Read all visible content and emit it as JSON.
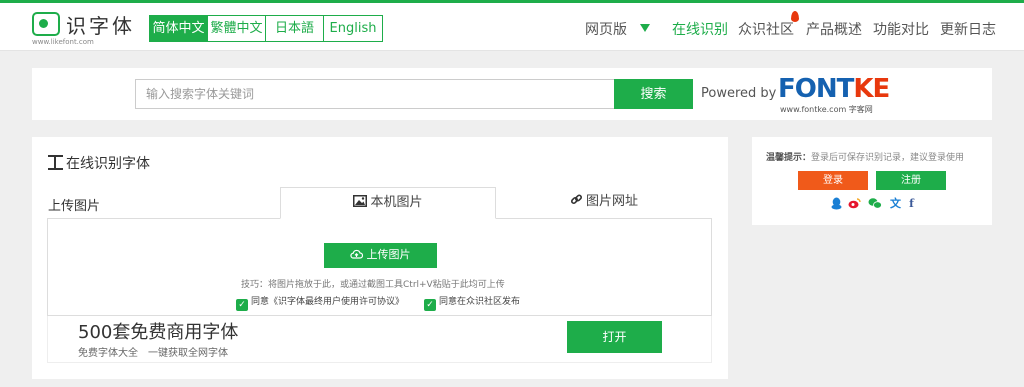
{
  "colors": {
    "brand": "#1ead4a",
    "login": "#f05a1a",
    "fontke_red": "#e8380d",
    "fontke_blue": "#1561b0"
  },
  "header": {
    "logo_name": "识字体",
    "logo_url_text": "www.likefont.com",
    "languages": [
      "简体中文",
      "繁體中文",
      "日本語",
      "English"
    ],
    "active_language": "简体中文",
    "nav": {
      "web_version": "网页版",
      "online_recognize": "在线识别",
      "community": "众识社区",
      "product": "产品概述",
      "compare": "功能对比",
      "changelog": "更新日志"
    }
  },
  "search": {
    "placeholder": "输入搜索字体关键词",
    "button": "搜索",
    "powered_by": "Powered by",
    "fontke_logo": "FONTKE",
    "fontke_url": "www.fontke.com 字客网"
  },
  "main": {
    "title": "在线识别字体",
    "upload_label": "上传图片",
    "tabs": [
      "本机图片",
      "图片网址"
    ],
    "upload_button": "上传图片",
    "tip": "技巧：将图片拖放于此，或通过截图工具Ctrl+V粘贴于此均可上传",
    "agree_license": "同意《识字体最终用户使用许可协议》",
    "agree_publish": "同意在众识社区发布"
  },
  "promo": {
    "title": "500套免费商用字体",
    "subtitle": "免费字体大全　一键获取全网字体",
    "button": "打开"
  },
  "sidebar": {
    "tip_label": "温馨提示：",
    "tip_text": "登录后可保存识别记录，建议登录使用",
    "login": "登录",
    "register": "注册",
    "social_icons": [
      "qq-icon",
      "weibo-icon",
      "wechat-icon",
      "translate-icon",
      "facebook-icon"
    ]
  }
}
